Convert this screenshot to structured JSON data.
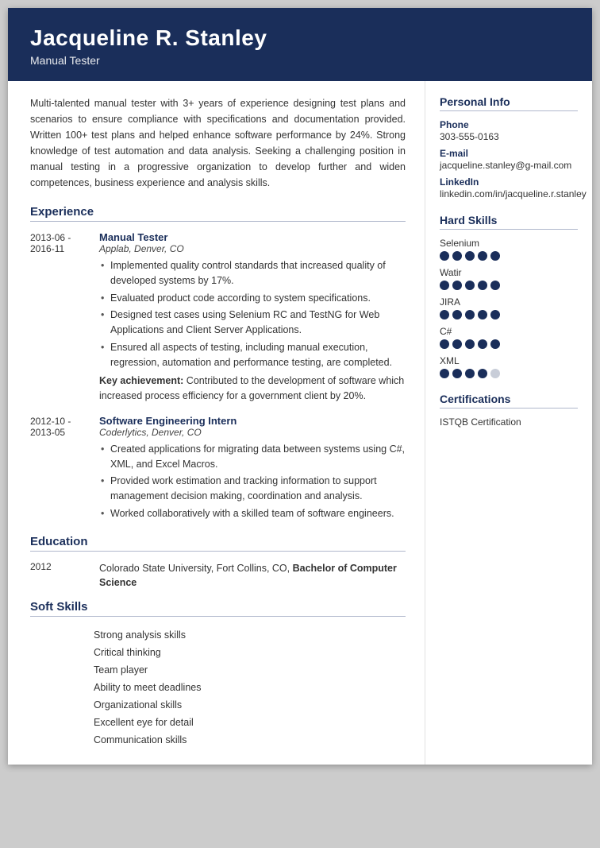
{
  "header": {
    "name": "Jacqueline R. Stanley",
    "title": "Manual Tester"
  },
  "summary": "Multi-talented manual tester with 3+ years of experience designing test plans and scenarios to ensure compliance with specifications and documentation provided. Written 100+ test plans and helped enhance software performance by 24%. Strong knowledge of test automation and data analysis. Seeking a challenging position in manual testing in a progressive organization to develop further and widen competences, business experience and analysis skills.",
  "experience": {
    "section_title": "Experience",
    "items": [
      {
        "date_start": "2013-06 -",
        "date_end": "2016-11",
        "job_title": "Manual Tester",
        "company": "Applab, Denver, CO",
        "bullets": [
          "Implemented quality control standards that increased quality of developed systems by 17%.",
          "Evaluated product code according to system specifications.",
          "Designed test cases using Selenium RC and TestNG for Web Applications and Client Server Applications.",
          "Ensured all aspects of testing, including manual execution, regression, automation and performance testing, are completed."
        ],
        "key_achievement": "Contributed to the development of software which increased process efficiency for a government client by 20%."
      },
      {
        "date_start": "2012-10 -",
        "date_end": "2013-05",
        "job_title": "Software Engineering Intern",
        "company": "Coderlytics, Denver, CO",
        "bullets": [
          "Created applications for migrating data between systems using C#, XML, and Excel Macros.",
          "Provided work estimation and tracking information to support management decision making, coordination and analysis.",
          "Worked collaboratively with a skilled team of software engineers."
        ],
        "key_achievement": null
      }
    ]
  },
  "education": {
    "section_title": "Education",
    "items": [
      {
        "year": "2012",
        "description_plain": "Colorado State University, Fort Collins, CO,",
        "description_bold": "Bachelor of Computer Science"
      }
    ]
  },
  "soft_skills": {
    "section_title": "Soft Skills",
    "items": [
      "Strong analysis skills",
      "Critical thinking",
      "Team player",
      "Ability to meet deadlines",
      "Organizational skills",
      "Excellent eye for detail",
      "Communication skills"
    ]
  },
  "personal_info": {
    "section_title": "Personal Info",
    "phone_label": "Phone",
    "phone_value": "303-555-0163",
    "email_label": "E-mail",
    "email_value": "jacqueline.stanley@g-mail.com",
    "linkedin_label": "LinkedIn",
    "linkedin_value": "linkedin.com/in/jacqueline.r.stanley"
  },
  "hard_skills": {
    "section_title": "Hard Skills",
    "items": [
      {
        "name": "Selenium",
        "filled": 5,
        "total": 5
      },
      {
        "name": "Watir",
        "filled": 5,
        "total": 5
      },
      {
        "name": "JIRA",
        "filled": 5,
        "total": 5
      },
      {
        "name": "C#",
        "filled": 5,
        "total": 5
      },
      {
        "name": "XML",
        "filled": 4,
        "total": 5
      }
    ]
  },
  "certifications": {
    "section_title": "Certifications",
    "items": [
      "ISTQB Certification"
    ]
  },
  "colors": {
    "dark_blue": "#1a2e5a",
    "white": "#ffffff",
    "dot_filled": "#1a2e5a",
    "dot_empty": "#c8cdd8"
  }
}
